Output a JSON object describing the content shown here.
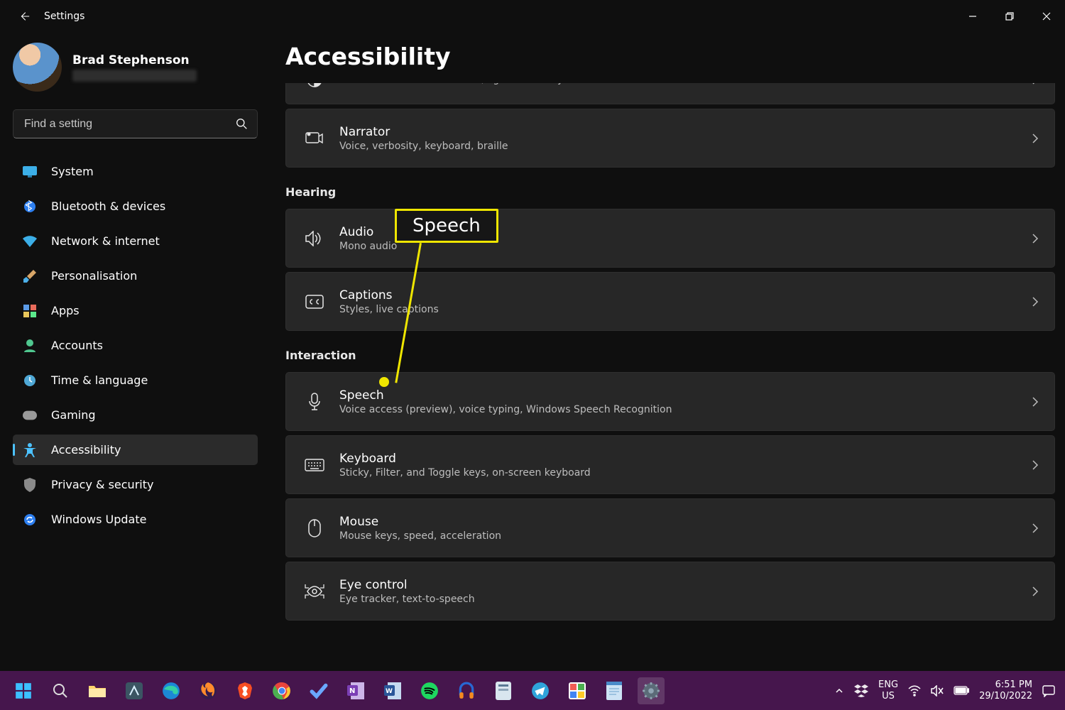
{
  "titlebar": {
    "title": "Settings"
  },
  "user": {
    "name": "Brad Stephenson"
  },
  "search": {
    "placeholder": "Find a setting"
  },
  "sidebar": [
    {
      "icon": "monitor",
      "label": "System"
    },
    {
      "icon": "bluetooth",
      "label": "Bluetooth & devices"
    },
    {
      "icon": "wifi",
      "label": "Network & internet"
    },
    {
      "icon": "brush",
      "label": "Personalisation"
    },
    {
      "icon": "apps",
      "label": "Apps"
    },
    {
      "icon": "person",
      "label": "Accounts"
    },
    {
      "icon": "clock",
      "label": "Time & language"
    },
    {
      "icon": "gamepad",
      "label": "Gaming"
    },
    {
      "icon": "accessibility",
      "label": "Accessibility",
      "active": true
    },
    {
      "icon": "shield",
      "label": "Privacy & security"
    },
    {
      "icon": "update",
      "label": "Windows Update"
    }
  ],
  "page": {
    "title": "Accessibility"
  },
  "groups": [
    {
      "label": "",
      "items": [
        {
          "icon": "contrast",
          "title": "",
          "sub": "Colour themes for low vision, light sensitivity",
          "partial": true
        },
        {
          "icon": "narrator",
          "title": "Narrator",
          "sub": "Voice, verbosity, keyboard, braille"
        }
      ]
    },
    {
      "label": "Hearing",
      "items": [
        {
          "icon": "speaker",
          "title": "Audio",
          "sub": "Mono audio"
        },
        {
          "icon": "cc",
          "title": "Captions",
          "sub": "Styles, live captions"
        }
      ]
    },
    {
      "label": "Interaction",
      "items": [
        {
          "icon": "mic",
          "title": "Speech",
          "sub": "Voice access (preview), voice typing, Windows Speech Recognition"
        },
        {
          "icon": "keyboard",
          "title": "Keyboard",
          "sub": "Sticky, Filter, and Toggle keys, on-screen keyboard"
        },
        {
          "icon": "mouse",
          "title": "Mouse",
          "sub": "Mouse keys, speed, acceleration"
        },
        {
          "icon": "eye",
          "title": "Eye control",
          "sub": "Eye tracker, text-to-speech"
        }
      ]
    }
  ],
  "callout": {
    "label": "Speech"
  },
  "systray": {
    "lang1": "ENG",
    "lang2": "US",
    "time": "6:51 PM",
    "date": "29/10/2022"
  }
}
